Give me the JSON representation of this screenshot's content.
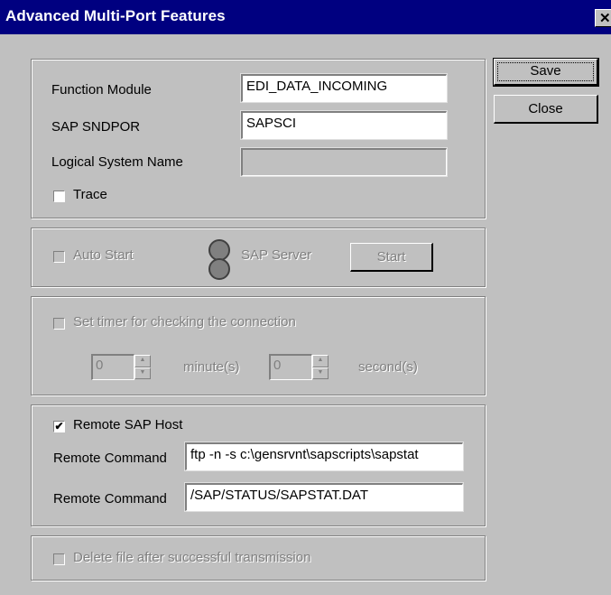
{
  "window": {
    "title": "Advanced Multi-Port Features",
    "close_glyph": "✕"
  },
  "buttons": {
    "save": "Save",
    "close": "Close",
    "start": "Start"
  },
  "module": {
    "function_module_label": "Function Module",
    "function_module_value": "EDI_DATA_INCOMING",
    "sap_sndpor_label": "SAP SNDPOR",
    "sap_sndpor_value": "SAPSCI",
    "logical_system_label": "Logical System Name",
    "logical_system_value": "",
    "trace_label": "Trace",
    "trace_checked": false
  },
  "autostart": {
    "label": "Auto Start",
    "checked": false,
    "server_label": "SAP Server",
    "led_icon": "status-led-icon"
  },
  "timer": {
    "label": "Set timer for checking the connection",
    "checked": false,
    "minutes_value": "0",
    "minutes_label": "minute(s)",
    "seconds_value": "0",
    "seconds_label": "second(s)"
  },
  "remote": {
    "label": "Remote SAP Host",
    "checked": true,
    "command1_label": "Remote Command",
    "command1_value": "ftp -n -s c:\\gensrvnt\\sapscripts\\sapstat",
    "command2_label": "Remote Command",
    "command2_value": "/SAP/STATUS/SAPSTAT.DAT"
  },
  "delete": {
    "label": "Delete file after successful transmission",
    "checked": false
  },
  "colors": {
    "titlebar": "#000080",
    "face": "#c0c0c0",
    "disabled_text": "#808080"
  }
}
